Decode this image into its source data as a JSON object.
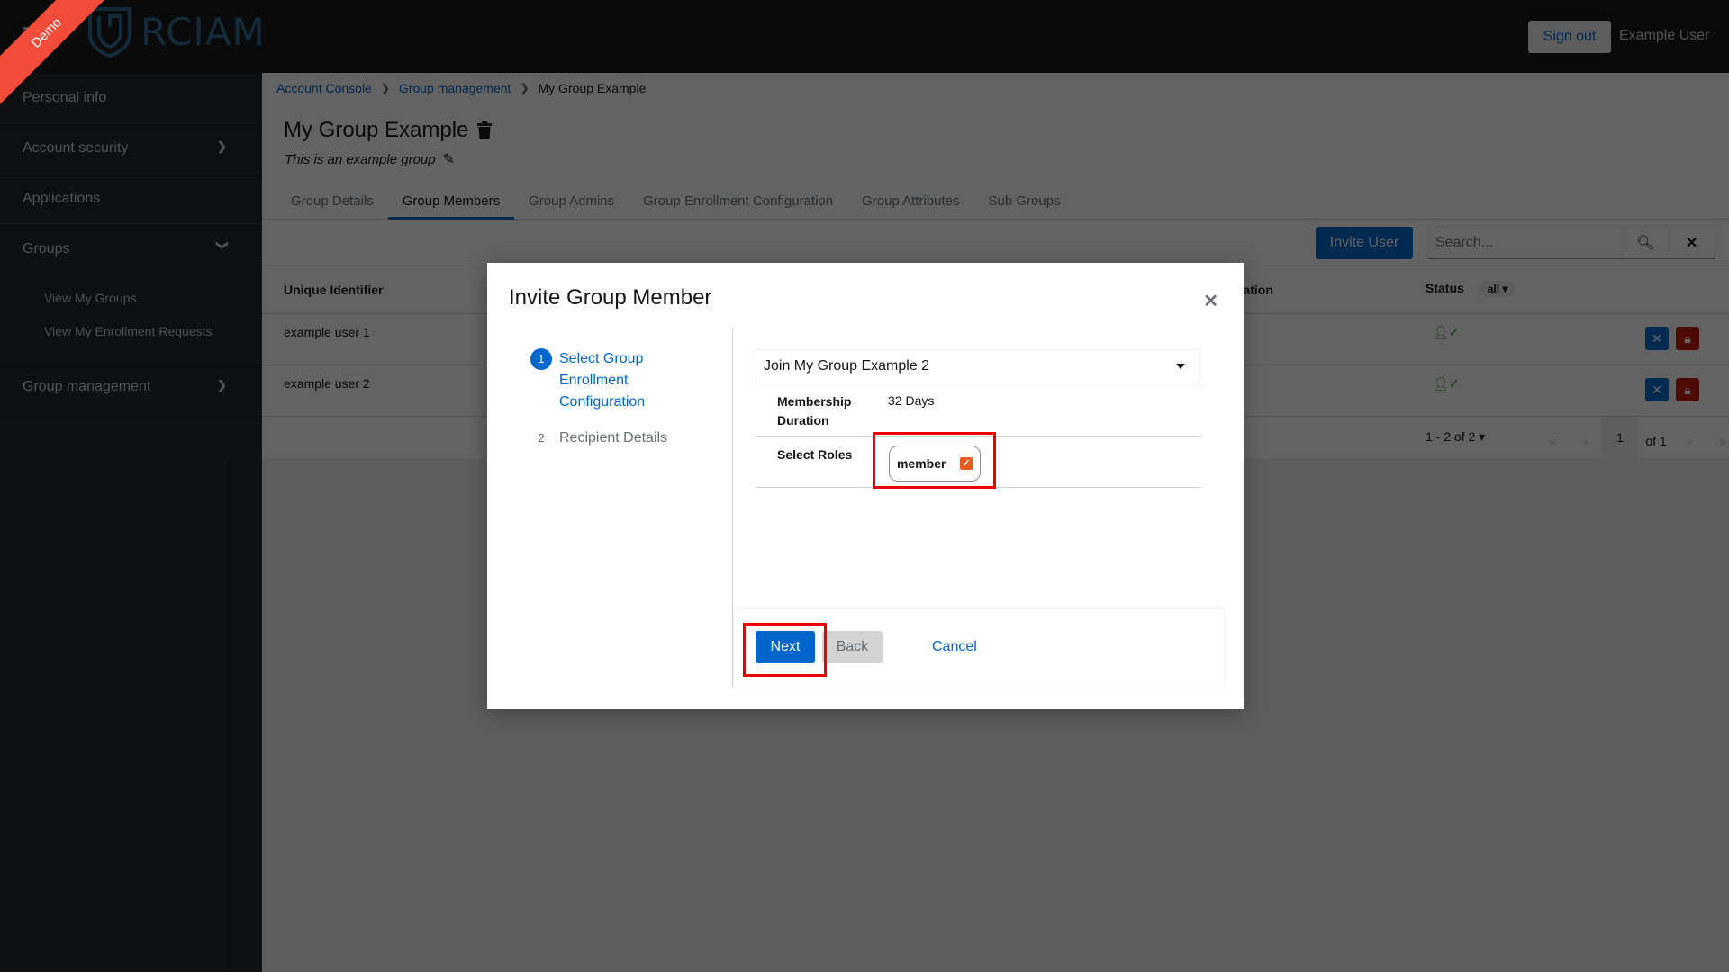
{
  "header": {
    "logo_text": "RCIAM",
    "ribbon_label": "Demo",
    "signout_label": "Sign out",
    "username": "Example User"
  },
  "sidebar": {
    "items": [
      {
        "label": "Personal info"
      },
      {
        "label": "Account security",
        "chevron": "chevron-right"
      },
      {
        "label": "Applications"
      },
      {
        "label": "Groups",
        "chevron": "chevron-down",
        "subitems": [
          {
            "label": "View My Groups"
          },
          {
            "label": "View My Enrollment Requests"
          }
        ]
      },
      {
        "label": "Group management",
        "chevron": "chevron-right"
      }
    ]
  },
  "breadcrumb": {
    "items": [
      "Account Console",
      "Group management",
      "My Group Example"
    ]
  },
  "page": {
    "title": "My Group Example",
    "description": "This is an example group"
  },
  "tabs": [
    {
      "label": "Group Details"
    },
    {
      "label": "Group Members",
      "active": true
    },
    {
      "label": "Group Admins"
    },
    {
      "label": "Group Enrollment Configuration"
    },
    {
      "label": "Group Attributes"
    },
    {
      "label": "Sub Groups"
    }
  ],
  "toolbar": {
    "invite_label": "Invite User",
    "search_placeholder": "Search..."
  },
  "table": {
    "columns": [
      "Unique Identifier",
      "ration",
      "Status"
    ],
    "status_filter": "all",
    "rows": [
      {
        "id": "example user 1",
        "status": "active-user-icon"
      },
      {
        "id": "example user 2",
        "status": "active-user-icon"
      }
    ]
  },
  "pagination": {
    "range": "1 - 2 of 2",
    "page": "1",
    "of_pages": "of 1"
  },
  "modal": {
    "title": "Invite Group Member",
    "steps": [
      {
        "num": "1",
        "label": "Select Group Enrollment Configuration",
        "active": true
      },
      {
        "num": "2",
        "label": "Recipient Details",
        "active": false
      }
    ],
    "enrollment_select_value": "Join My Group Example 2",
    "membership_duration_label": "Membership Duration",
    "membership_duration_value": "32 Days",
    "select_roles_label": "Select Roles",
    "roles": [
      {
        "label": "member",
        "checked": true
      }
    ],
    "next_label": "Next",
    "back_label": "Back",
    "cancel_label": "Cancel"
  },
  "colors": {
    "primary": "#0066cc",
    "danger": "#c9190b",
    "ribbon": "#f44c3a",
    "highlight": "#ee0000",
    "checkbox": "#ee5a24"
  }
}
